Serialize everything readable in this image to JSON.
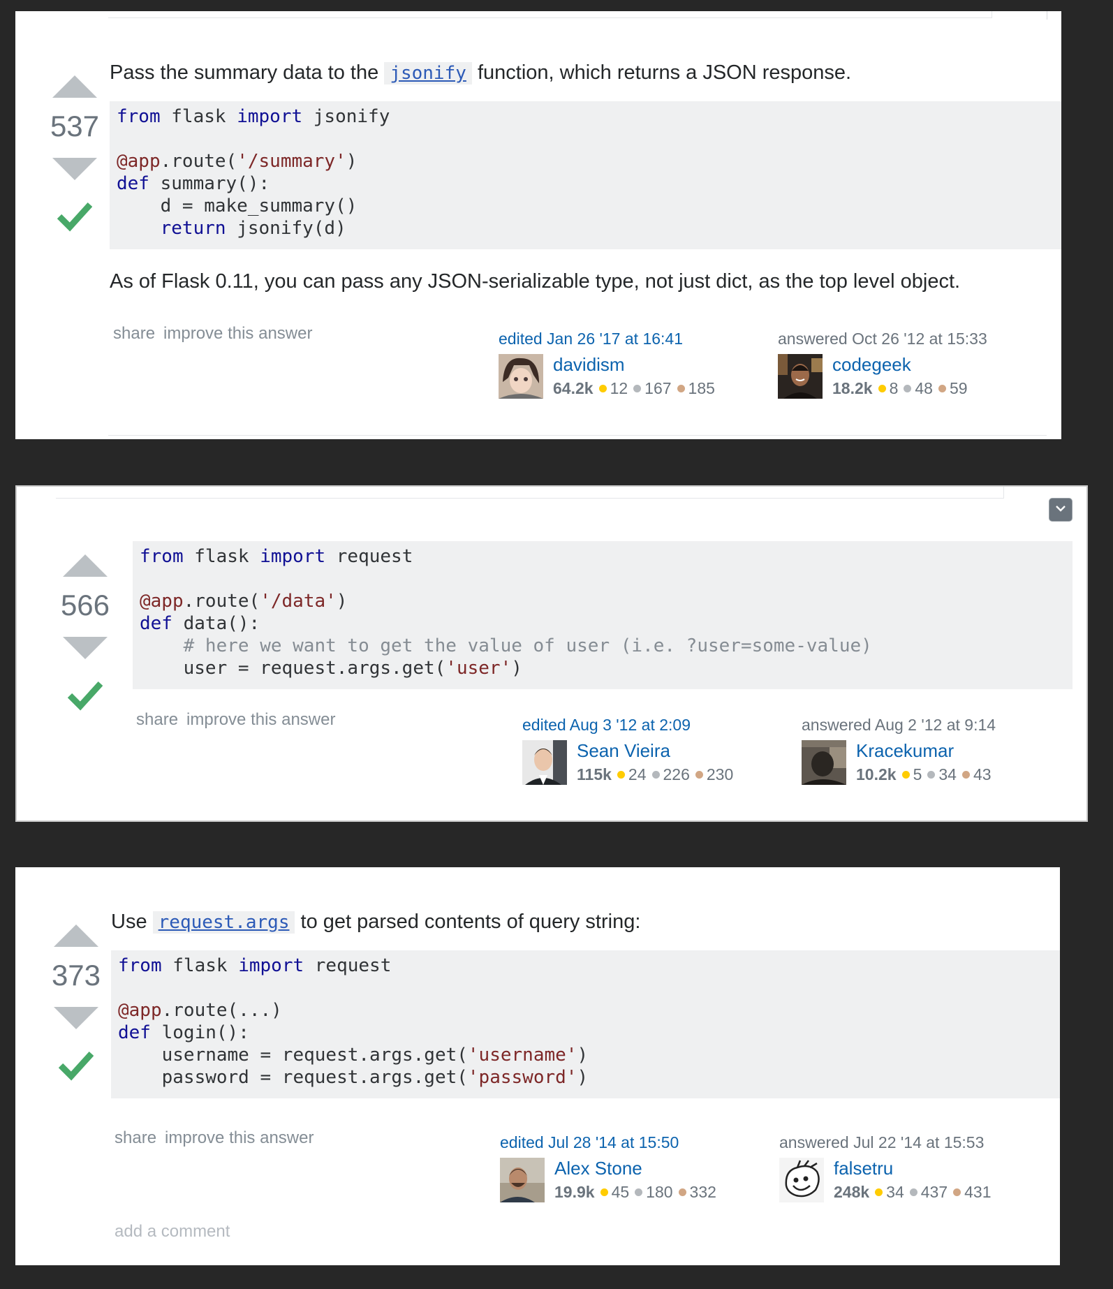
{
  "answers": [
    {
      "votes": "537",
      "intro": [
        "Pass the summary data to the ",
        "jsonify",
        " function, which returns a JSON response."
      ],
      "code": [
        [
          [
            "kw",
            "from"
          ],
          [
            "t",
            " flask "
          ],
          [
            "kw",
            "import"
          ],
          [
            "t",
            " jsonify"
          ]
        ],
        [],
        [
          [
            "dec",
            "@app"
          ],
          [
            "t",
            ".route("
          ],
          [
            "str",
            "'/summary'"
          ],
          [
            "t",
            ")"
          ]
        ],
        [
          [
            "kw",
            "def"
          ],
          [
            "t",
            " summary():"
          ]
        ],
        [
          [
            "t",
            "    d = make_summary()"
          ]
        ],
        [
          [
            "t",
            "    "
          ],
          [
            "kw",
            "return"
          ],
          [
            "t",
            " jsonify(d)"
          ]
        ]
      ],
      "after": "As of Flask 0.11, you can pass any JSON-serializable type, not just dict, as the top level object.",
      "share": "share",
      "improve": "improve this answer",
      "edited": {
        "action": "edited Jan 26 '17 at 16:41",
        "user": "davidism",
        "rep": "64.2k",
        "gold": "12",
        "silver": "167",
        "bronze": "185"
      },
      "answered": {
        "action": "answered Oct 26 '12 at 15:33",
        "user": "codegeek",
        "rep": "18.2k",
        "gold": "8",
        "silver": "48",
        "bronze": "59"
      }
    },
    {
      "votes": "566",
      "code": [
        [
          [
            "kw",
            "from"
          ],
          [
            "t",
            " flask "
          ],
          [
            "kw",
            "import"
          ],
          [
            "t",
            " request"
          ]
        ],
        [],
        [
          [
            "dec",
            "@app"
          ],
          [
            "t",
            ".route("
          ],
          [
            "str",
            "'/data'"
          ],
          [
            "t",
            ")"
          ]
        ],
        [
          [
            "kw",
            "def"
          ],
          [
            "t",
            " data():"
          ]
        ],
        [
          [
            "t",
            "    "
          ],
          [
            "cmt",
            "# here we want to get the value of user (i.e. ?user=some-value)"
          ]
        ],
        [
          [
            "t",
            "    user = request.args.get("
          ],
          [
            "str",
            "'user'"
          ],
          [
            "t",
            ")"
          ]
        ]
      ],
      "share": "share",
      "improve": "improve this answer",
      "edited": {
        "action": "edited Aug 3 '12 at 2:09",
        "user": "Sean Vieira",
        "rep": "115k",
        "gold": "24",
        "silver": "226",
        "bronze": "230"
      },
      "answered": {
        "action": "answered Aug 2 '12 at 9:14",
        "user": "Kracekumar",
        "rep": "10.2k",
        "gold": "5",
        "silver": "34",
        "bronze": "43"
      }
    },
    {
      "votes": "373",
      "intro": [
        "Use ",
        "request.args",
        " to get parsed contents of query string:"
      ],
      "code": [
        [
          [
            "kw",
            "from"
          ],
          [
            "t",
            " flask "
          ],
          [
            "kw",
            "import"
          ],
          [
            "t",
            " request"
          ]
        ],
        [],
        [
          [
            "dec",
            "@app"
          ],
          [
            "t",
            ".route(...)"
          ]
        ],
        [
          [
            "kw",
            "def"
          ],
          [
            "t",
            " login():"
          ]
        ],
        [
          [
            "t",
            "    username = request.args.get("
          ],
          [
            "str",
            "'username'"
          ],
          [
            "t",
            ")"
          ]
        ],
        [
          [
            "t",
            "    password = request.args.get("
          ],
          [
            "str",
            "'password'"
          ],
          [
            "t",
            ")"
          ]
        ]
      ],
      "share": "share",
      "improve": "improve this answer",
      "edited": {
        "action": "edited Jul 28 '14 at 15:50",
        "user": "Alex Stone",
        "rep": "19.9k",
        "gold": "45",
        "silver": "180",
        "bronze": "332"
      },
      "answered": {
        "action": "answered Jul 22 '14 at 15:53",
        "user": "falsetru",
        "rep": "248k",
        "gold": "34",
        "silver": "437",
        "bronze": "431"
      },
      "add_comment": "add a comment"
    }
  ],
  "icons": {
    "upvote": "upvote-arrow-icon",
    "downvote": "downvote-arrow-icon",
    "accepted": "accepted-check-icon",
    "collapse": "chevron-down-icon"
  },
  "colors": {
    "accepted": "#48a868",
    "link": "#0c63ae",
    "code_bg": "#eff0f1",
    "gold": "#ffcc01",
    "silver": "#b4b8bc",
    "bronze": "#d1a684"
  }
}
